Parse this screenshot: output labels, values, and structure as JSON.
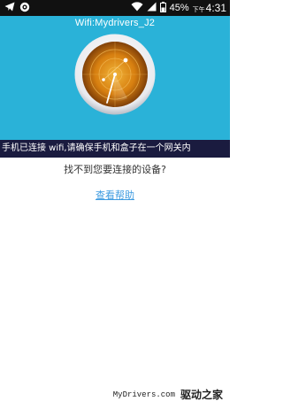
{
  "status_bar": {
    "battery_percent": "45%",
    "time_period": "下午",
    "time": "4:31",
    "icons": [
      "telegram-icon",
      "app-notification-icon",
      "wifi-icon",
      "signal-icon",
      "battery-icon"
    ]
  },
  "header": {
    "wifi_label": "Wifi:Mydrivers_J2"
  },
  "notice": {
    "text": "手机已连接 wifi,请确保手机和盒子在一个网关内"
  },
  "main": {
    "question": "找不到您要连接的设备?",
    "help_link": "查看帮助"
  },
  "watermark": {
    "domain": "MyDrivers.com",
    "brand": "驱动之家"
  },
  "colors": {
    "hero_bg": "#2ab2d8",
    "notice_bg": "#1a1b3f",
    "link": "#3d9be0",
    "status_bar_bg": "#111111"
  }
}
